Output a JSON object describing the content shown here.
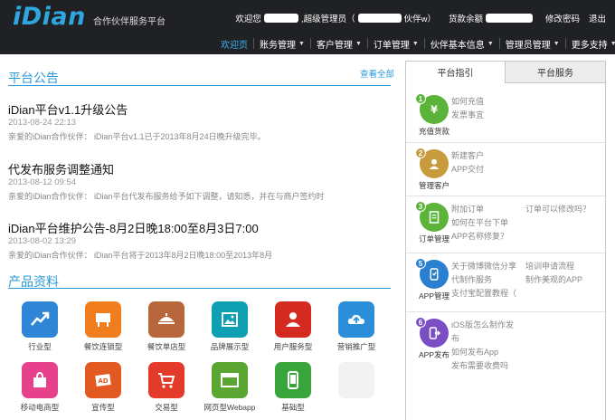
{
  "header": {
    "logo": "iDian",
    "subtitle": "合作伙伴服务平台",
    "welcome": "欢迎您",
    "role": ",超级管理员（",
    "partner_suffix": "伙伴w）",
    "balance_label": "货款余额",
    "change_password": "修改密码",
    "logout": "退出"
  },
  "nav": [
    {
      "label": "欢迎页",
      "active": true,
      "dropdown": false
    },
    {
      "label": "账务管理",
      "dropdown": true
    },
    {
      "label": "客户管理",
      "dropdown": true
    },
    {
      "label": "订单管理",
      "dropdown": true
    },
    {
      "label": "伙伴基本信息",
      "dropdown": true
    },
    {
      "label": "管理员管理",
      "dropdown": true
    },
    {
      "label": "更多支持",
      "dropdown": true
    }
  ],
  "announcements": {
    "title": "平台公告",
    "view_all": "查看全部",
    "items": [
      {
        "title": "iDian平台v1.1升级公告",
        "date": "2013-08-24 22:13",
        "summary": "亲爱的iDian合作伙伴： iDian平台v1.1已于2013年8月24日晚升级完毕。"
      },
      {
        "title": "代发布服务调整通知",
        "date": "2013-08-12 09:54",
        "summary": "亲爱的iDian合作伙伴： iDian平台代发布服务给予如下调整，请知悉，并在与商户签约时"
      },
      {
        "title": "iDian平台维护公告-8月2日晚18:00至8月3日7:00",
        "date": "2013-08-02 13:29",
        "summary": "亲爱的iDian合作伙伴： iDian平台将于2013年8月2日晚18:00至2013年8月"
      }
    ]
  },
  "products": {
    "title": "产品资料",
    "items": [
      {
        "label": "行业型",
        "icon": "chart-up-icon",
        "color": "#2f86d6"
      },
      {
        "label": "餐饮连锁型",
        "icon": "board-icon",
        "color": "#f07d1e"
      },
      {
        "label": "餐饮单店型",
        "icon": "dish-icon",
        "color": "#b8673d"
      },
      {
        "label": "品牌展示型",
        "icon": "picture-icon",
        "color": "#0f9fb3"
      },
      {
        "label": "用户服务型",
        "icon": "service-person-icon",
        "color": "#d42a20"
      },
      {
        "label": "营销推广型",
        "icon": "cloud-upload-icon",
        "color": "#2a8fd8"
      },
      {
        "label": "移动电商型",
        "icon": "shopping-bag-icon",
        "color": "#e6418a"
      },
      {
        "label": "宣传型",
        "icon": "ad-icon",
        "color": "#e25a22"
      },
      {
        "label": "交易型",
        "icon": "cart-icon",
        "color": "#e33a2a"
      },
      {
        "label": "网页型Webapp",
        "icon": "browser-icon",
        "color": "#5aa631"
      },
      {
        "label": "基础型",
        "icon": "phone-icon",
        "color": "#3aa53c"
      }
    ]
  },
  "right_panel": {
    "tabs": [
      {
        "label": "平台指引",
        "active": true
      },
      {
        "label": "平台服务",
        "active": false
      }
    ],
    "guides": [
      {
        "num": "1",
        "caption": "充值货款",
        "icon": "yuan-icon",
        "color": "#5bb33a",
        "links": [
          "如何充值",
          "发票事宜"
        ],
        "links2": []
      },
      {
        "num": "2",
        "caption": "管理客户",
        "icon": "customer-icon",
        "color": "#c79a3c",
        "links": [
          "新建客户",
          "APP交付"
        ],
        "links2": []
      },
      {
        "num": "3",
        "caption": "订单管理",
        "icon": "order-icon",
        "color": "#5bb33a",
        "links": [
          "附加订单",
          "如何在平台下单",
          "APP名称修复？"
        ],
        "links2": [
          "订单可以修改吗？"
        ]
      },
      {
        "num": "5",
        "caption": "APP管理",
        "icon": "app-manage-icon",
        "color": "#2a7fd0",
        "links": [
          "关于微博微信分享",
          "代制作服务",
          "支付宝配置教程（"
        ],
        "links2": [
          "培训申请流程",
          "制作美观的APP"
        ]
      },
      {
        "num": "6",
        "caption": "APP发布",
        "icon": "app-publish-icon",
        "color": "#7a4fc4",
        "links": [
          "iOS版怎么制作发",
          "布",
          "如何发布App",
          "发布需要收费吗"
        ],
        "links2": []
      }
    ]
  }
}
